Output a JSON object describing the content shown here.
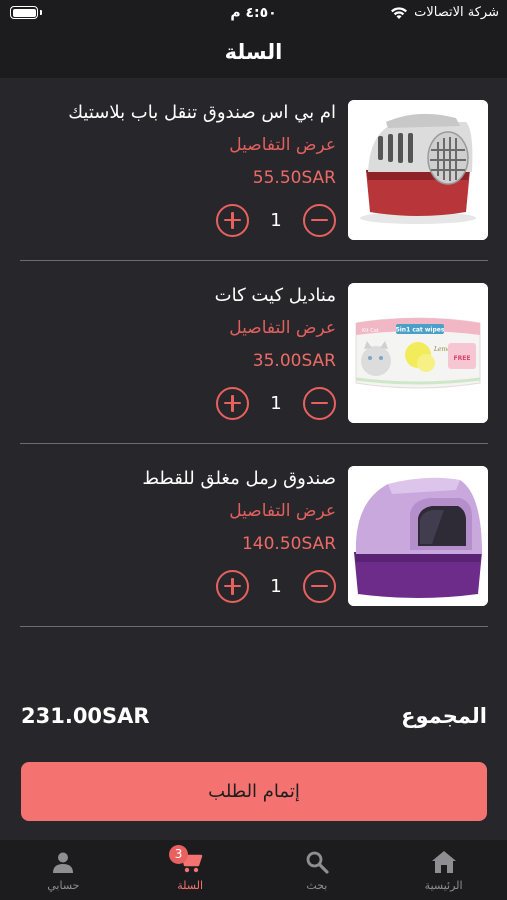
{
  "status_bar": {
    "time": "٤:٥٠ م",
    "carrier": "شركة الاتصالات"
  },
  "header": {
    "title": "السلة"
  },
  "cart": {
    "items": [
      {
        "name": "ام بي اس صندوق تنقل باب بلاستيك",
        "details_label": "عرض التفاصيل",
        "price": "55.50SAR",
        "quantity": "1",
        "image_icon": "pet-carrier-image"
      },
      {
        "name": "مناديل كيت كات",
        "details_label": "عرض التفاصيل",
        "price": "35.00SAR",
        "quantity": "1",
        "image_icon": "cat-wipes-image",
        "image_text": {
          "brand": "Kit Cat",
          "line1": "5in1 cat wipes",
          "line2": "Lemon",
          "line3": "FREE"
        }
      },
      {
        "name": "صندوق رمل مغلق للقطط",
        "details_label": "عرض التفاصيل",
        "price": "140.50SAR",
        "quantity": "1",
        "image_icon": "litter-box-image"
      }
    ]
  },
  "summary": {
    "total_label": "المجموع",
    "total_amount": "231.00SAR"
  },
  "checkout": {
    "label": "إتمام الطلب"
  },
  "tabbar": {
    "tabs": [
      {
        "label": "الرئيسية",
        "icon": "home-icon"
      },
      {
        "label": "بحث",
        "icon": "search-icon"
      },
      {
        "label": "السلة",
        "icon": "cart-icon",
        "badge": "3",
        "active": true
      },
      {
        "label": "حسابي",
        "icon": "person-icon"
      }
    ]
  },
  "colors": {
    "background": "#27272b",
    "bar": "#1c1c1e",
    "accent": "#f47370",
    "accent_dark": "#e8615f"
  }
}
